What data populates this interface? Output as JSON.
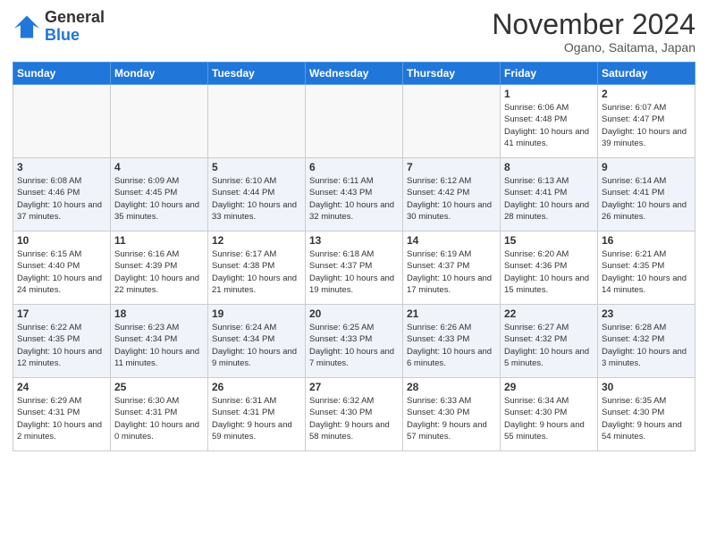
{
  "header": {
    "logo_general": "General",
    "logo_blue": "Blue",
    "title": "November 2024",
    "location": "Ogano, Saitama, Japan"
  },
  "columns": [
    "Sunday",
    "Monday",
    "Tuesday",
    "Wednesday",
    "Thursday",
    "Friday",
    "Saturday"
  ],
  "weeks": [
    [
      {
        "day": "",
        "info": "",
        "empty": true
      },
      {
        "day": "",
        "info": "",
        "empty": true
      },
      {
        "day": "",
        "info": "",
        "empty": true
      },
      {
        "day": "",
        "info": "",
        "empty": true
      },
      {
        "day": "",
        "info": "",
        "empty": true
      },
      {
        "day": "1",
        "info": "Sunrise: 6:06 AM\nSunset: 4:48 PM\nDaylight: 10 hours\nand 41 minutes."
      },
      {
        "day": "2",
        "info": "Sunrise: 6:07 AM\nSunset: 4:47 PM\nDaylight: 10 hours\nand 39 minutes."
      }
    ],
    [
      {
        "day": "3",
        "info": "Sunrise: 6:08 AM\nSunset: 4:46 PM\nDaylight: 10 hours\nand 37 minutes."
      },
      {
        "day": "4",
        "info": "Sunrise: 6:09 AM\nSunset: 4:45 PM\nDaylight: 10 hours\nand 35 minutes."
      },
      {
        "day": "5",
        "info": "Sunrise: 6:10 AM\nSunset: 4:44 PM\nDaylight: 10 hours\nand 33 minutes."
      },
      {
        "day": "6",
        "info": "Sunrise: 6:11 AM\nSunset: 4:43 PM\nDaylight: 10 hours\nand 32 minutes."
      },
      {
        "day": "7",
        "info": "Sunrise: 6:12 AM\nSunset: 4:42 PM\nDaylight: 10 hours\nand 30 minutes."
      },
      {
        "day": "8",
        "info": "Sunrise: 6:13 AM\nSunset: 4:41 PM\nDaylight: 10 hours\nand 28 minutes."
      },
      {
        "day": "9",
        "info": "Sunrise: 6:14 AM\nSunset: 4:41 PM\nDaylight: 10 hours\nand 26 minutes."
      }
    ],
    [
      {
        "day": "10",
        "info": "Sunrise: 6:15 AM\nSunset: 4:40 PM\nDaylight: 10 hours\nand 24 minutes."
      },
      {
        "day": "11",
        "info": "Sunrise: 6:16 AM\nSunset: 4:39 PM\nDaylight: 10 hours\nand 22 minutes."
      },
      {
        "day": "12",
        "info": "Sunrise: 6:17 AM\nSunset: 4:38 PM\nDaylight: 10 hours\nand 21 minutes."
      },
      {
        "day": "13",
        "info": "Sunrise: 6:18 AM\nSunset: 4:37 PM\nDaylight: 10 hours\nand 19 minutes."
      },
      {
        "day": "14",
        "info": "Sunrise: 6:19 AM\nSunset: 4:37 PM\nDaylight: 10 hours\nand 17 minutes."
      },
      {
        "day": "15",
        "info": "Sunrise: 6:20 AM\nSunset: 4:36 PM\nDaylight: 10 hours\nand 15 minutes."
      },
      {
        "day": "16",
        "info": "Sunrise: 6:21 AM\nSunset: 4:35 PM\nDaylight: 10 hours\nand 14 minutes."
      }
    ],
    [
      {
        "day": "17",
        "info": "Sunrise: 6:22 AM\nSunset: 4:35 PM\nDaylight: 10 hours\nand 12 minutes."
      },
      {
        "day": "18",
        "info": "Sunrise: 6:23 AM\nSunset: 4:34 PM\nDaylight: 10 hours\nand 11 minutes."
      },
      {
        "day": "19",
        "info": "Sunrise: 6:24 AM\nSunset: 4:34 PM\nDaylight: 10 hours\nand 9 minutes."
      },
      {
        "day": "20",
        "info": "Sunrise: 6:25 AM\nSunset: 4:33 PM\nDaylight: 10 hours\nand 7 minutes."
      },
      {
        "day": "21",
        "info": "Sunrise: 6:26 AM\nSunset: 4:33 PM\nDaylight: 10 hours\nand 6 minutes."
      },
      {
        "day": "22",
        "info": "Sunrise: 6:27 AM\nSunset: 4:32 PM\nDaylight: 10 hours\nand 5 minutes."
      },
      {
        "day": "23",
        "info": "Sunrise: 6:28 AM\nSunset: 4:32 PM\nDaylight: 10 hours\nand 3 minutes."
      }
    ],
    [
      {
        "day": "24",
        "info": "Sunrise: 6:29 AM\nSunset: 4:31 PM\nDaylight: 10 hours\nand 2 minutes."
      },
      {
        "day": "25",
        "info": "Sunrise: 6:30 AM\nSunset: 4:31 PM\nDaylight: 10 hours\nand 0 minutes."
      },
      {
        "day": "26",
        "info": "Sunrise: 6:31 AM\nSunset: 4:31 PM\nDaylight: 9 hours\nand 59 minutes."
      },
      {
        "day": "27",
        "info": "Sunrise: 6:32 AM\nSunset: 4:30 PM\nDaylight: 9 hours\nand 58 minutes."
      },
      {
        "day": "28",
        "info": "Sunrise: 6:33 AM\nSunset: 4:30 PM\nDaylight: 9 hours\nand 57 minutes."
      },
      {
        "day": "29",
        "info": "Sunrise: 6:34 AM\nSunset: 4:30 PM\nDaylight: 9 hours\nand 55 minutes."
      },
      {
        "day": "30",
        "info": "Sunrise: 6:35 AM\nSunset: 4:30 PM\nDaylight: 9 hours\nand 54 minutes."
      }
    ]
  ]
}
